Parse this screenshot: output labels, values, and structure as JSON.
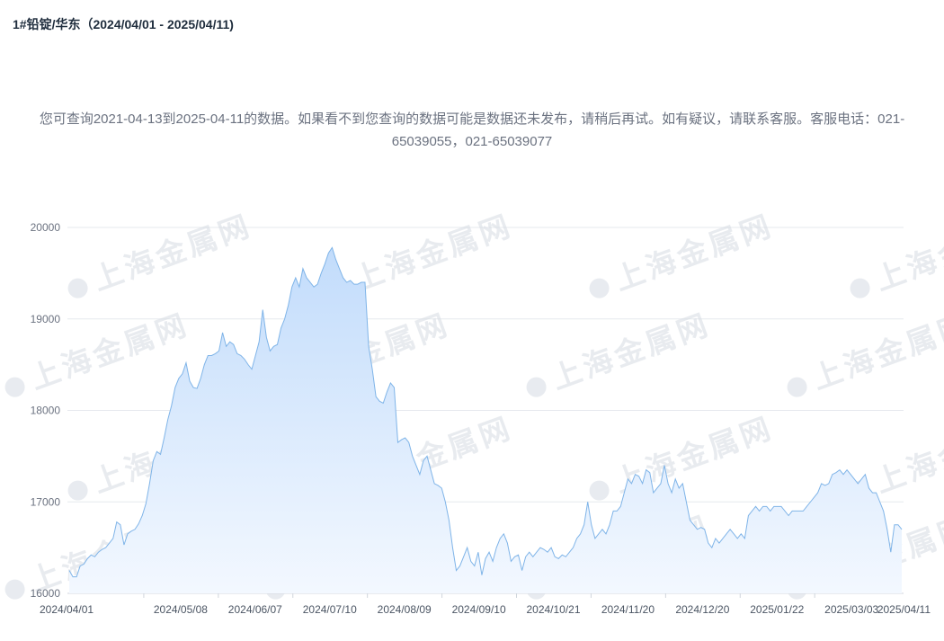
{
  "title": "1#铅锭/华东（2024/04/01 - 2025/04/11)",
  "notice": "您可查询2021-04-13到2025-04-11的数据。如果看不到您查询的数据可能是数据还未发布，请稍后再试。如有疑议，请联系客服。客服电话：021-65039055，021-65039077",
  "watermark": "上海金属网",
  "colors": {
    "line": "#7fb4e8",
    "fill_top": "#c2dcfb",
    "fill_bottom": "#f3f8ff",
    "grid": "#e6e9ee"
  },
  "chart_data": {
    "type": "area",
    "title": "",
    "xlabel": "",
    "ylabel": "",
    "ylim": [
      16000,
      20000
    ],
    "y_ticks": [
      16000,
      17000,
      18000,
      19000,
      20000
    ],
    "x_tick_labels": [
      "2024/04/01",
      "2024/05/08",
      "2024/06/07",
      "2024/07/10",
      "2024/08/09",
      "2024/09/10",
      "2024/10/21",
      "2024/11/20",
      "2024/12/20",
      "2025/01/22",
      "2025/03/03",
      "2025/04/11"
    ],
    "grid": true,
    "legend": "none",
    "series": [
      {
        "values": [
          16250,
          16180,
          16180,
          16300,
          16320,
          16380,
          16420,
          16400,
          16450,
          16480,
          16500,
          16550,
          16600,
          16780,
          16750,
          16530,
          16650,
          16680,
          16700,
          16760,
          16850,
          16980,
          17200,
          17450,
          17550,
          17520,
          17700,
          17900,
          18050,
          18250,
          18350,
          18400,
          18520,
          18320,
          18250,
          18240,
          18350,
          18500,
          18600,
          18600,
          18620,
          18650,
          18850,
          18700,
          18750,
          18720,
          18620,
          18600,
          18560,
          18500,
          18450,
          18600,
          18750,
          19100,
          18800,
          18650,
          18700,
          18720,
          18900,
          19000,
          19150,
          19350,
          19450,
          19350,
          19550,
          19450,
          19400,
          19350,
          19380,
          19500,
          19600,
          19720,
          19780,
          19650,
          19550,
          19450,
          19400,
          19420,
          19380,
          19380,
          19400,
          19400,
          18700,
          18450,
          18150,
          18100,
          18080,
          18200,
          18300,
          18250,
          17650,
          17680,
          17700,
          17650,
          17500,
          17400,
          17300,
          17450,
          17500,
          17350,
          17200,
          17180,
          17150,
          17000,
          16800,
          16500,
          16250,
          16300,
          16400,
          16500,
          16350,
          16300,
          16450,
          16200,
          16380,
          16450,
          16350,
          16500,
          16600,
          16650,
          16550,
          16350,
          16400,
          16420,
          16250,
          16400,
          16450,
          16400,
          16450,
          16500,
          16480,
          16450,
          16500,
          16400,
          16380,
          16420,
          16400,
          16450,
          16500,
          16600,
          16650,
          16750,
          17000,
          16750,
          16600,
          16650,
          16700,
          16650,
          16750,
          16900,
          16900,
          16950,
          17100,
          17250,
          17200,
          17300,
          17280,
          17200,
          17350,
          17320,
          17100,
          17150,
          17200,
          17400,
          17200,
          17100,
          17250,
          17150,
          17200,
          17000,
          16800,
          16750,
          16700,
          16720,
          16700,
          16550,
          16500,
          16600,
          16550,
          16600,
          16650,
          16700,
          16650,
          16600,
          16650,
          16600,
          16850,
          16900,
          16950,
          16900,
          16950,
          16950,
          16900,
          16950,
          16950,
          16950,
          16900,
          16850,
          16900,
          16900,
          16900,
          16900,
          16950,
          17000,
          17050,
          17100,
          17200,
          17180,
          17200,
          17300,
          17320,
          17350,
          17300,
          17350,
          17300,
          17250,
          17200,
          17250,
          17300,
          17150,
          17100,
          17100,
          17000,
          16900,
          16700,
          16450,
          16750,
          16750,
          16700
        ]
      }
    ]
  }
}
